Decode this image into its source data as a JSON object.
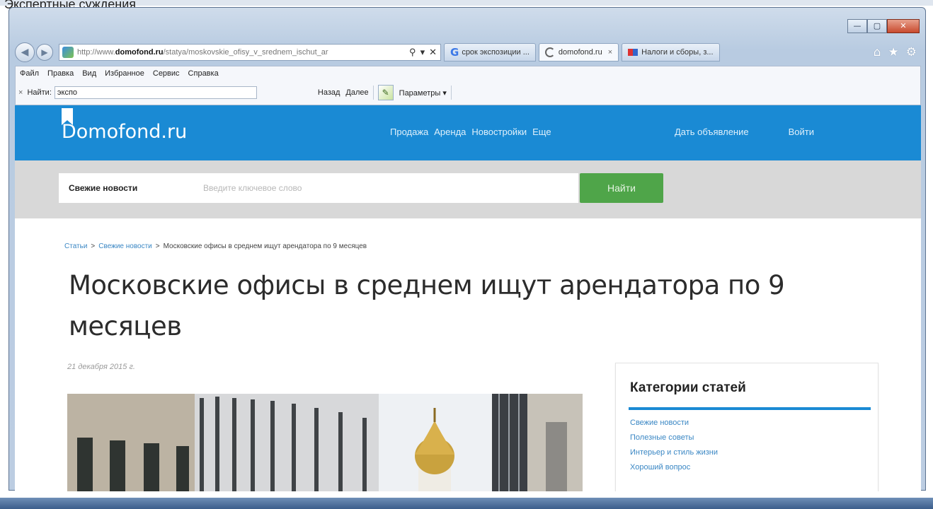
{
  "backdrop": {
    "label": "Экспертные суждения"
  },
  "window": {
    "minimize": "—",
    "maximize": "▢",
    "close": "✕"
  },
  "browser": {
    "address": {
      "prefix": "http://www.",
      "domain": "domofond.ru",
      "path": "/statya/moskovskie_ofisy_v_srednem_ischut_ar",
      "search_glyph": "⚲",
      "dropdown_glyph": "▾",
      "stop_glyph": "✕"
    },
    "tabs": [
      {
        "label": "срок экспозиции ...",
        "icon": "google-icon"
      },
      {
        "label": "domofond.ru",
        "icon": "loading-icon",
        "close": "×",
        "active": true
      },
      {
        "label": "Налоги и сборы, з...",
        "icon": "flag-icon"
      }
    ],
    "menu": [
      "Файл",
      "Правка",
      "Вид",
      "Избранное",
      "Сервис",
      "Справка"
    ],
    "find": {
      "close": "×",
      "label": "Найти:",
      "value": "экспо",
      "prev": "Назад",
      "next": "Далее",
      "options": "Параметры ▾"
    }
  },
  "site": {
    "logo": "Domofond.ru",
    "nav": [
      "Продажа",
      "Аренда",
      "Новостройки",
      "Еще"
    ],
    "post_ad": "Дать объявление",
    "login": "Войти",
    "search": {
      "label": "Свежие новости",
      "placeholder": "Введите ключевое слово",
      "button": "Найти"
    },
    "breadcrumb": {
      "root": "Статьи",
      "section": "Свежие новости",
      "current": "Московские офисы в среднем ищут арендатора по 9 месяцев",
      "separator": ">"
    },
    "article": {
      "title": "Московские офисы в среднем ищут арендатора по 9 месяцев",
      "date": "21 декабря 2015 г."
    },
    "sidebar": {
      "title": "Категории статей",
      "items": [
        "Свежие новости",
        "Полезные советы",
        "Интерьер и стиль жизни",
        "Хороший вопрос"
      ]
    }
  },
  "colors": {
    "brand_blue": "#1a8ad4",
    "search_green": "#4fa549",
    "link_blue": "#3a87c4"
  }
}
